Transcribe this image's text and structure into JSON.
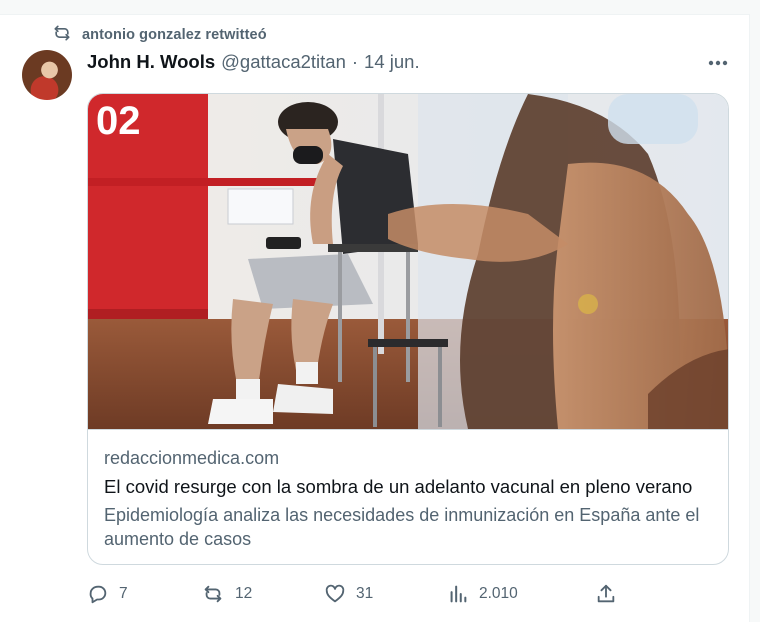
{
  "retweet": {
    "text": "antonio gonzalez retwitteó",
    "icon": "retweet-icon"
  },
  "tweet": {
    "author_name": "John H. Wools",
    "handle": "@gattaca2titan",
    "separator": "·",
    "date": "14 jun."
  },
  "link_card": {
    "domain": "redaccionmedica.com",
    "title": "El covid resurge con la sombra de un adelanto vacunal en pleno verano",
    "description": "Epidemiología analiza las necesidades de inmunización en España ante el aumento de casos",
    "image_sign_text": "02"
  },
  "actions": {
    "replies": "7",
    "retweets": "12",
    "likes": "31",
    "views": "2.010"
  },
  "colors": {
    "text_primary": "#0f1419",
    "text_secondary": "#536471",
    "border": "#cfd9de"
  }
}
